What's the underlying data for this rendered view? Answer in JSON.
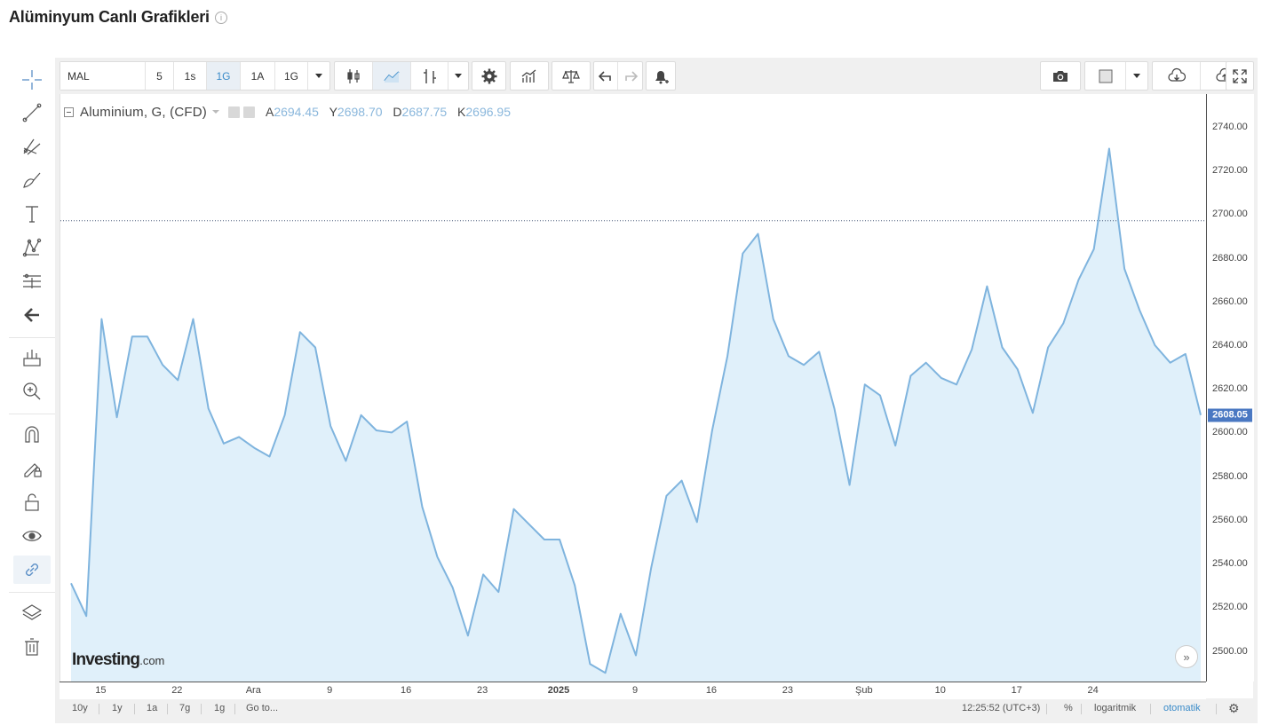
{
  "page": {
    "title": "Alüminyum Canlı Grafikleri",
    "info_icon": "info-icon"
  },
  "toolbar": {
    "symbol": "MAL",
    "intervals": [
      {
        "label": "5",
        "active": false
      },
      {
        "label": "1s",
        "active": false
      },
      {
        "label": "1G",
        "active": true
      },
      {
        "label": "1A",
        "active": false
      }
    ],
    "interval_dropdown": "1G",
    "icons": [
      "candles-icon",
      "line-chart-icon",
      "indicator-icon",
      "settings-icon",
      "bars-icon",
      "compare-icon",
      "undo-icon",
      "redo-icon",
      "alert-icon",
      "camera-icon",
      "color-icon",
      "cloud-download-icon",
      "cloud-upload-icon",
      "fullscreen-icon"
    ]
  },
  "left_tools": [
    "crosshair-icon",
    "trend-line-icon",
    "pitchfork-icon",
    "brush-icon",
    "text-icon",
    "pattern-icon",
    "measure-icon",
    "back-arrow-icon",
    "ruler-icon",
    "zoom-in-icon",
    "magnet-icon",
    "lock-drawing-icon",
    "unlock-icon",
    "eye-icon",
    "link-icon",
    "layers-icon",
    "trash-icon"
  ],
  "legend": {
    "title": "Aluminium, G, (CFD)",
    "ohlc": [
      {
        "key": "A",
        "value": "2694.45"
      },
      {
        "key": "Y",
        "value": "2698.70"
      },
      {
        "key": "D",
        "value": "2687.75"
      },
      {
        "key": "K",
        "value": "2696.95"
      }
    ]
  },
  "watermark": {
    "brand": "Investing",
    "suffix": ".com"
  },
  "chart_data": {
    "type": "area",
    "series": [
      {
        "values": [
          2531,
          2516,
          2652,
          2607,
          2644,
          2644,
          2631,
          2624,
          2652,
          2611,
          2595,
          2598,
          2593,
          2589,
          2608,
          2646,
          2639,
          2603,
          2587,
          2608,
          2601,
          2600,
          2605,
          2566,
          2543,
          2529,
          2507,
          2535,
          2527,
          2565,
          2558,
          2551,
          2551,
          2530,
          2494,
          2490,
          2517,
          2498,
          2538,
          2571,
          2578,
          2559,
          2601,
          2635,
          2682,
          2691,
          2652,
          2635,
          2631,
          2637,
          2611,
          2576,
          2622,
          2617,
          2594,
          2626,
          2632,
          2625,
          2622,
          2638,
          2667,
          2639,
          2629,
          2609,
          2639,
          2650,
          2670,
          2684,
          2730,
          2675,
          2656,
          2640,
          2632,
          2636,
          2608
        ]
      }
    ],
    "x_tick_labels": [
      {
        "label": "15",
        "index": 2,
        "bold": false
      },
      {
        "label": "22",
        "index": 7,
        "bold": false
      },
      {
        "label": "Ara",
        "index": 12,
        "bold": false
      },
      {
        "label": "9",
        "index": 17,
        "bold": false
      },
      {
        "label": "16",
        "index": 22,
        "bold": false
      },
      {
        "label": "23",
        "index": 27,
        "bold": false
      },
      {
        "label": "2025",
        "index": 32,
        "bold": true
      },
      {
        "label": "9",
        "index": 37,
        "bold": false
      },
      {
        "label": "16",
        "index": 42,
        "bold": false
      },
      {
        "label": "23",
        "index": 47,
        "bold": false
      },
      {
        "label": "Şub",
        "index": 52,
        "bold": false
      },
      {
        "label": "10",
        "index": 57,
        "bold": false
      },
      {
        "label": "17",
        "index": 62,
        "bold": false
      },
      {
        "label": "24",
        "index": 67,
        "bold": false
      }
    ],
    "y_ticks": [
      2500,
      2520,
      2540,
      2560,
      2580,
      2600,
      2620,
      2640,
      2660,
      2680,
      2700,
      2720,
      2740
    ],
    "y_tick_labels": [
      "2500.00",
      "2520.00",
      "2540.00",
      "2560.00",
      "2580.00",
      "2600.00",
      "2620.00",
      "2640.00",
      "2660.00",
      "2680.00",
      "2700.00",
      "2720.00",
      "2740.00"
    ],
    "ylim": [
      2486,
      2755
    ],
    "last_value": 2608.05,
    "last_value_label": "2608.05",
    "crosshair_value": 2697,
    "line_color": "#7fb4de",
    "fill_color": "#e0f0fa"
  },
  "bottom_bar": {
    "ranges": [
      "10y",
      "1y",
      "1a",
      "7g",
      "1g"
    ],
    "goto": "Go to...",
    "time": "12:25:52 (UTC+3)",
    "percent": "%",
    "log": "logaritmik",
    "auto": "otomatik"
  }
}
